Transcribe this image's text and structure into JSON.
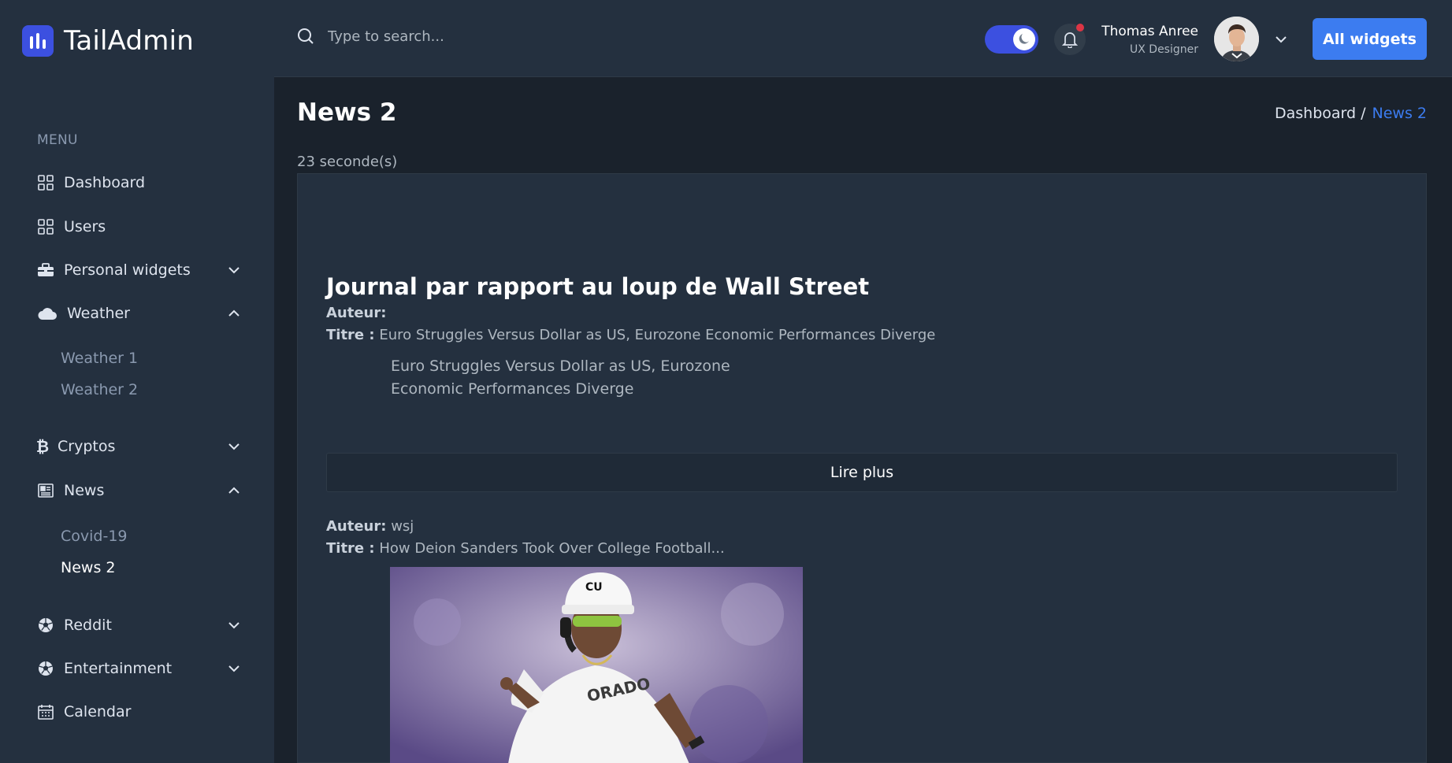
{
  "brand": {
    "name": "TailAdmin"
  },
  "sidebar": {
    "menu_title": "MENU",
    "items": [
      {
        "label": "Dashboard"
      },
      {
        "label": "Users"
      },
      {
        "label": "Personal widgets"
      },
      {
        "label": "Weather",
        "children": [
          "Weather 1",
          "Weather 2"
        ]
      },
      {
        "label": "Cryptos"
      },
      {
        "label": "News",
        "children": [
          "Covid-19",
          "News 2"
        ]
      },
      {
        "label": "Reddit"
      },
      {
        "label": "Entertainment"
      },
      {
        "label": "Calendar"
      }
    ]
  },
  "header": {
    "search_placeholder": "Type to search...",
    "user_name": "Thomas Anree",
    "user_role": "UX Designer",
    "all_widgets": "All widgets"
  },
  "page": {
    "title": "News 2",
    "breadcrumb_root": "Dashboard /",
    "breadcrumb_current": "News 2",
    "elapsed": "23 seconde(s)"
  },
  "article": {
    "heading": "Journal par rapport au loup de Wall Street",
    "author_label": "Auteur:",
    "title_label": "Titre :",
    "first": {
      "author": "",
      "title": "Euro Struggles Versus Dollar as US, Eurozone Economic Performances Diverge",
      "description": "Euro Struggles Versus Dollar as US, Eurozone Economic Performances Diverge"
    },
    "read_more": "Lire plus",
    "second": {
      "author": "wsj",
      "title": "How Deion Sanders Took Over College Football..."
    }
  },
  "colors": {
    "accent": "#3c50e0",
    "button": "#3c7cf0",
    "sidebar": "#24303f",
    "background": "#1a222c"
  }
}
